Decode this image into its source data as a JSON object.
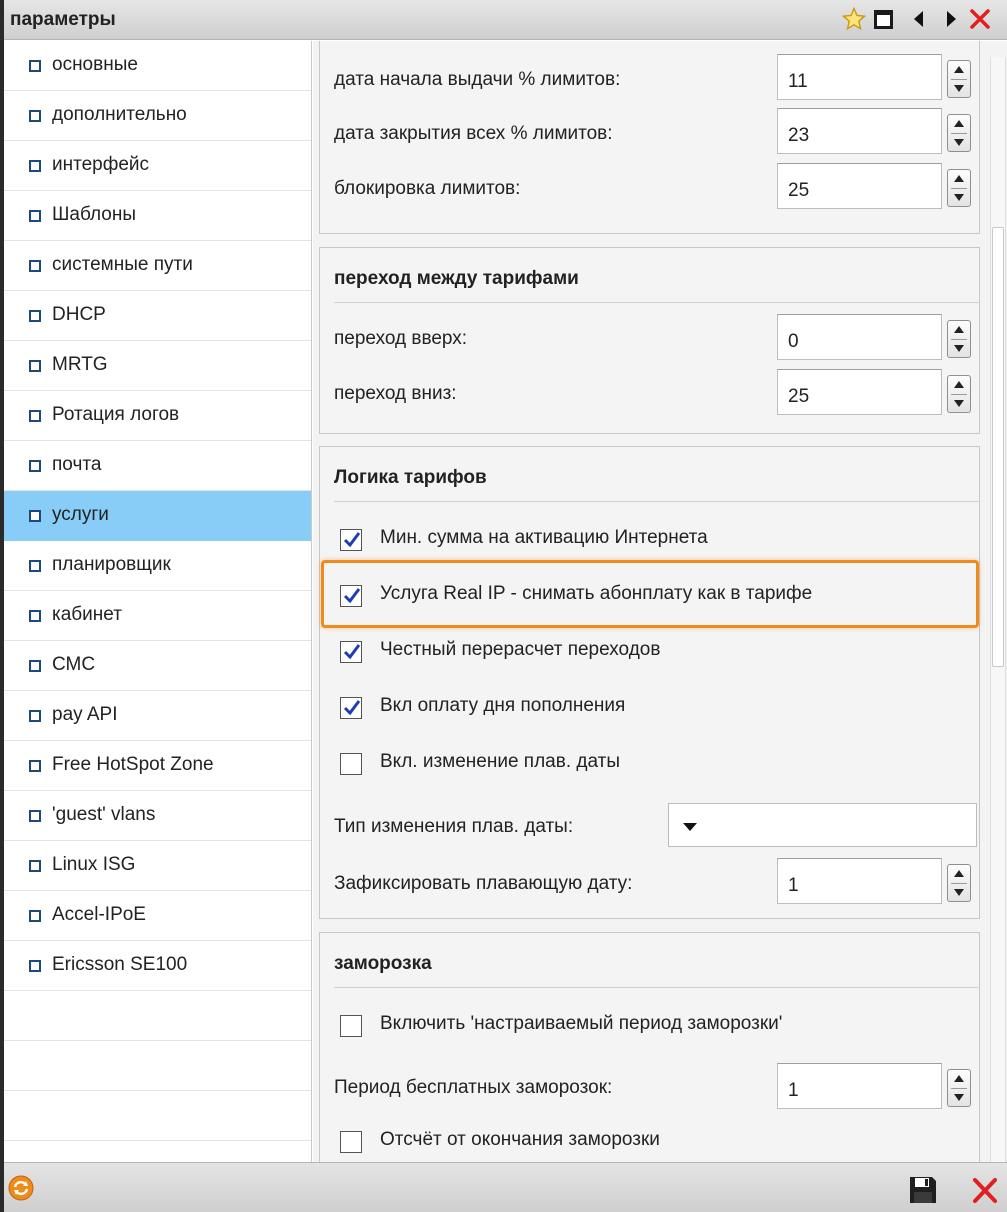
{
  "window": {
    "title": "параметры",
    "icons": [
      "star-icon",
      "maximize-icon",
      "arrow-left-icon",
      "arrow-right-icon",
      "close-icon"
    ]
  },
  "sidebar": {
    "items": [
      {
        "label": "основные"
      },
      {
        "label": "дополнительно"
      },
      {
        "label": "интерфейс"
      },
      {
        "label": "Шаблоны"
      },
      {
        "label": "системные пути"
      },
      {
        "label": "DHCP"
      },
      {
        "label": "MRTG"
      },
      {
        "label": "Ротация логов"
      },
      {
        "label": "почта"
      },
      {
        "label": "услуги"
      },
      {
        "label": "планировщик"
      },
      {
        "label": "кабинет"
      },
      {
        "label": "СМС"
      },
      {
        "label": "pay API"
      },
      {
        "label": "Free HotSpot Zone"
      },
      {
        "label": "'guest' vlans"
      },
      {
        "label": "Linux ISG"
      },
      {
        "label": "Accel-IPoE"
      },
      {
        "label": "Ericsson SE100"
      }
    ],
    "selected_label": "услуги"
  },
  "limits": {
    "start_label": "дата начала выдачи % лимитов:",
    "start_value": "11",
    "close_label": "дата закрытия всех % лимитов:",
    "close_value": "23",
    "block_label": "блокировка лимитов:",
    "block_value": "25"
  },
  "tariff_transition": {
    "title": "переход между тарифами",
    "up_label": "переход вверх:",
    "up_value": "0",
    "down_label": "переход вниз:",
    "down_value": "25"
  },
  "tariff_logic": {
    "title": "Логика тарифов",
    "checkboxes": [
      {
        "label": "Мин. сумма на активацию Интернета",
        "checked": true
      },
      {
        "label": "Услуга Real IP - снимать абонплату как в тарифе",
        "checked": true
      },
      {
        "label": "Честный перерасчет переходов",
        "checked": true
      },
      {
        "label": "Вкл оплату дня пополнения",
        "checked": true
      },
      {
        "label": "Вкл. изменение плав. даты",
        "checked": false
      }
    ],
    "change_type_label": "Тип изменения плав. даты:",
    "change_type_value": "",
    "fix_date_label": "Зафиксировать плавающую дату:",
    "fix_date_value": "1"
  },
  "freeze": {
    "title": "заморозка",
    "custom_period_label": "Включить 'настраиваемый период заморозки'",
    "custom_period_checked": false,
    "free_label": "Период бесплатных заморозок:",
    "free_value": "1",
    "from_end_label": "Отсчёт от окончания заморозки",
    "from_end_checked": false
  },
  "footer": {
    "icons": [
      "refresh-icon",
      "save-icon",
      "cancel-icon"
    ]
  },
  "colors": {
    "selected_bg": "#87cdf7",
    "highlight": "#ef8a1f",
    "close_red": "#e02020",
    "check_blue": "#1b3fb3"
  }
}
